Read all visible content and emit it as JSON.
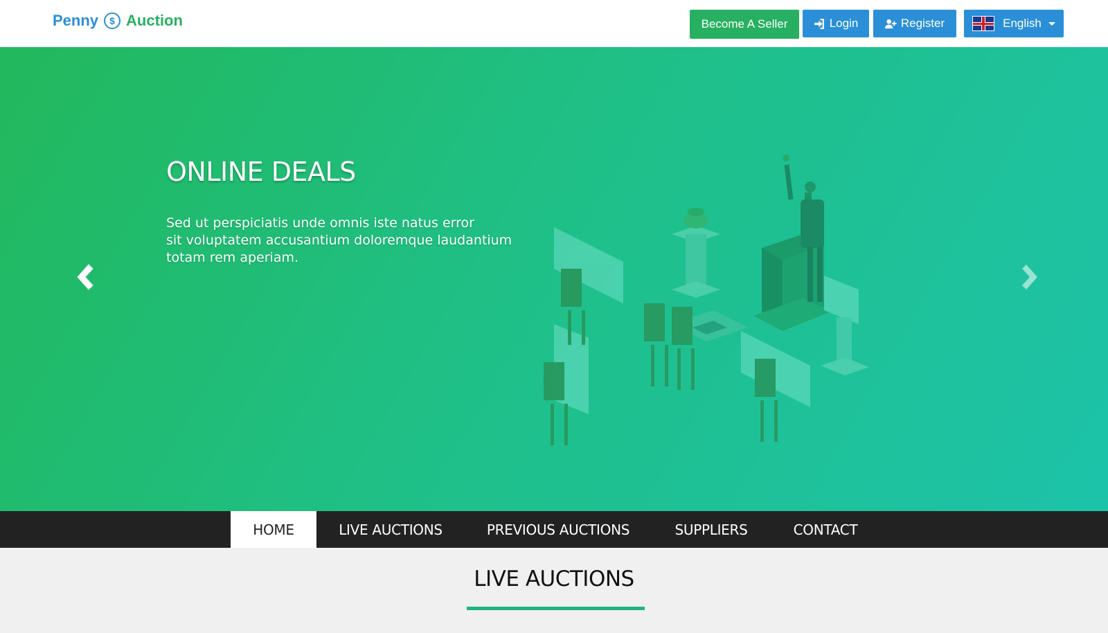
{
  "header": {
    "logo": {
      "word1": "Penny",
      "coin_symbol": "$",
      "word2": "Auction"
    },
    "buttons": {
      "seller": "Become A Seller",
      "login": "Login",
      "register": "Register",
      "language": "English"
    }
  },
  "hero": {
    "title": "ONLINE DEALS",
    "lines": [
      "Sed ut perspiciatis unde omnis iste natus error",
      "sit voluptatem accusantium doloremque laudantium",
      "totam rem aperiam."
    ],
    "slide_count": 3,
    "active_slide": 1
  },
  "nav": {
    "items": [
      "HOME",
      "LIVE AUCTIONS",
      "PREVIOUS AUCTIONS",
      "SUPPLIERS",
      "CONTACT"
    ],
    "active": "HOME"
  },
  "section": {
    "title": "LIVE AUCTIONS"
  },
  "colors": {
    "brand_blue": "#2a8fd6",
    "brand_green": "#27b061",
    "hero_start": "#22b85c",
    "hero_end": "#1dc3a9",
    "nav_bg": "#222222",
    "accent_underline": "#1fb385"
  },
  "icons": [
    "coin-icon",
    "sign-in-icon",
    "user-plus-icon",
    "uk-flag-icon",
    "caret-down-icon",
    "chevron-left-icon",
    "chevron-right-icon"
  ]
}
